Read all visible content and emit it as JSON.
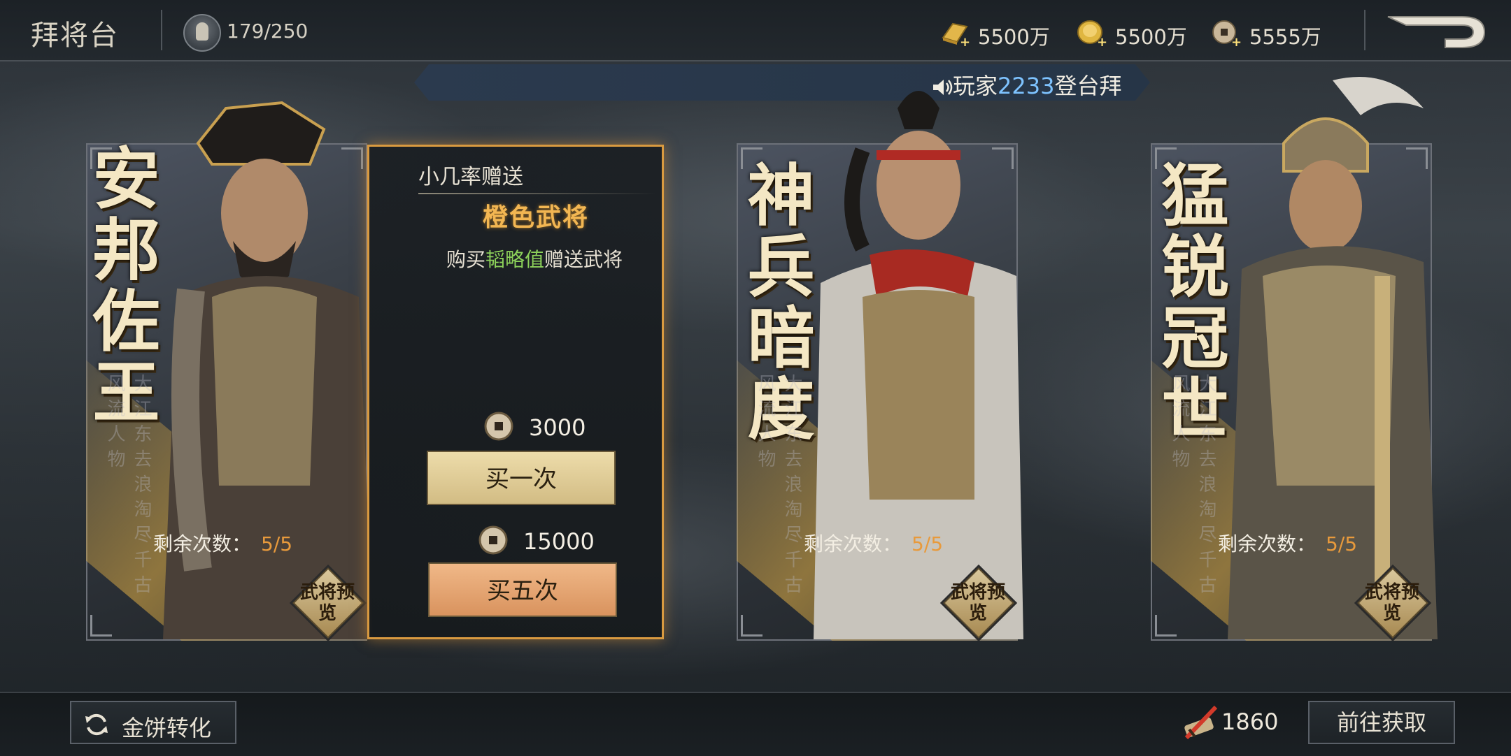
{
  "header": {
    "title": "拜将台",
    "stamina": "179/250",
    "resources": [
      {
        "icon": "gold-bar-icon",
        "value": "5500万"
      },
      {
        "icon": "gold-cake-icon",
        "value": "5500万"
      },
      {
        "icon": "copper-coin-icon",
        "value": "5555万"
      }
    ]
  },
  "marquee": {
    "prefix": "玩家",
    "player": "2233",
    "suffix": "登台拜"
  },
  "cards": [
    {
      "name": "安邦佐王",
      "poem": "大江东去浪淘尽千古风流人物",
      "remain_label": "剩余次数：",
      "remain_value": "5/5",
      "preview_label": "武将预览"
    },
    {
      "name": "神兵暗度",
      "poem": "大江东去浪淘尽千古风流人物",
      "remain_label": "剩余次数：",
      "remain_value": "5/5",
      "preview_label": "武将预览"
    },
    {
      "name": "猛锐冠世",
      "poem": "大江东去浪淘尽千古风流人物",
      "remain_label": "剩余次数：",
      "remain_value": "5/5",
      "preview_label": "武将预览"
    }
  ],
  "gift_panel": {
    "subtitle": "小几率赠送",
    "title": "橙色武将",
    "desc_prefix": "购买",
    "desc_highlight": "韬略值",
    "desc_suffix": "赠送武将",
    "price_once": "3000",
    "buy_once_label": "买一次",
    "price_five": "15000",
    "buy_five_label": "买五次"
  },
  "footer": {
    "convert_label": "金饼转化",
    "token_value": "1860",
    "goto_label": "前往获取"
  },
  "colors": {
    "accent_orange": "#f2b652",
    "highlight_green": "#8cd15a",
    "marquee_blue": "#7ec3ff",
    "remain_orange": "#e89a3c"
  }
}
